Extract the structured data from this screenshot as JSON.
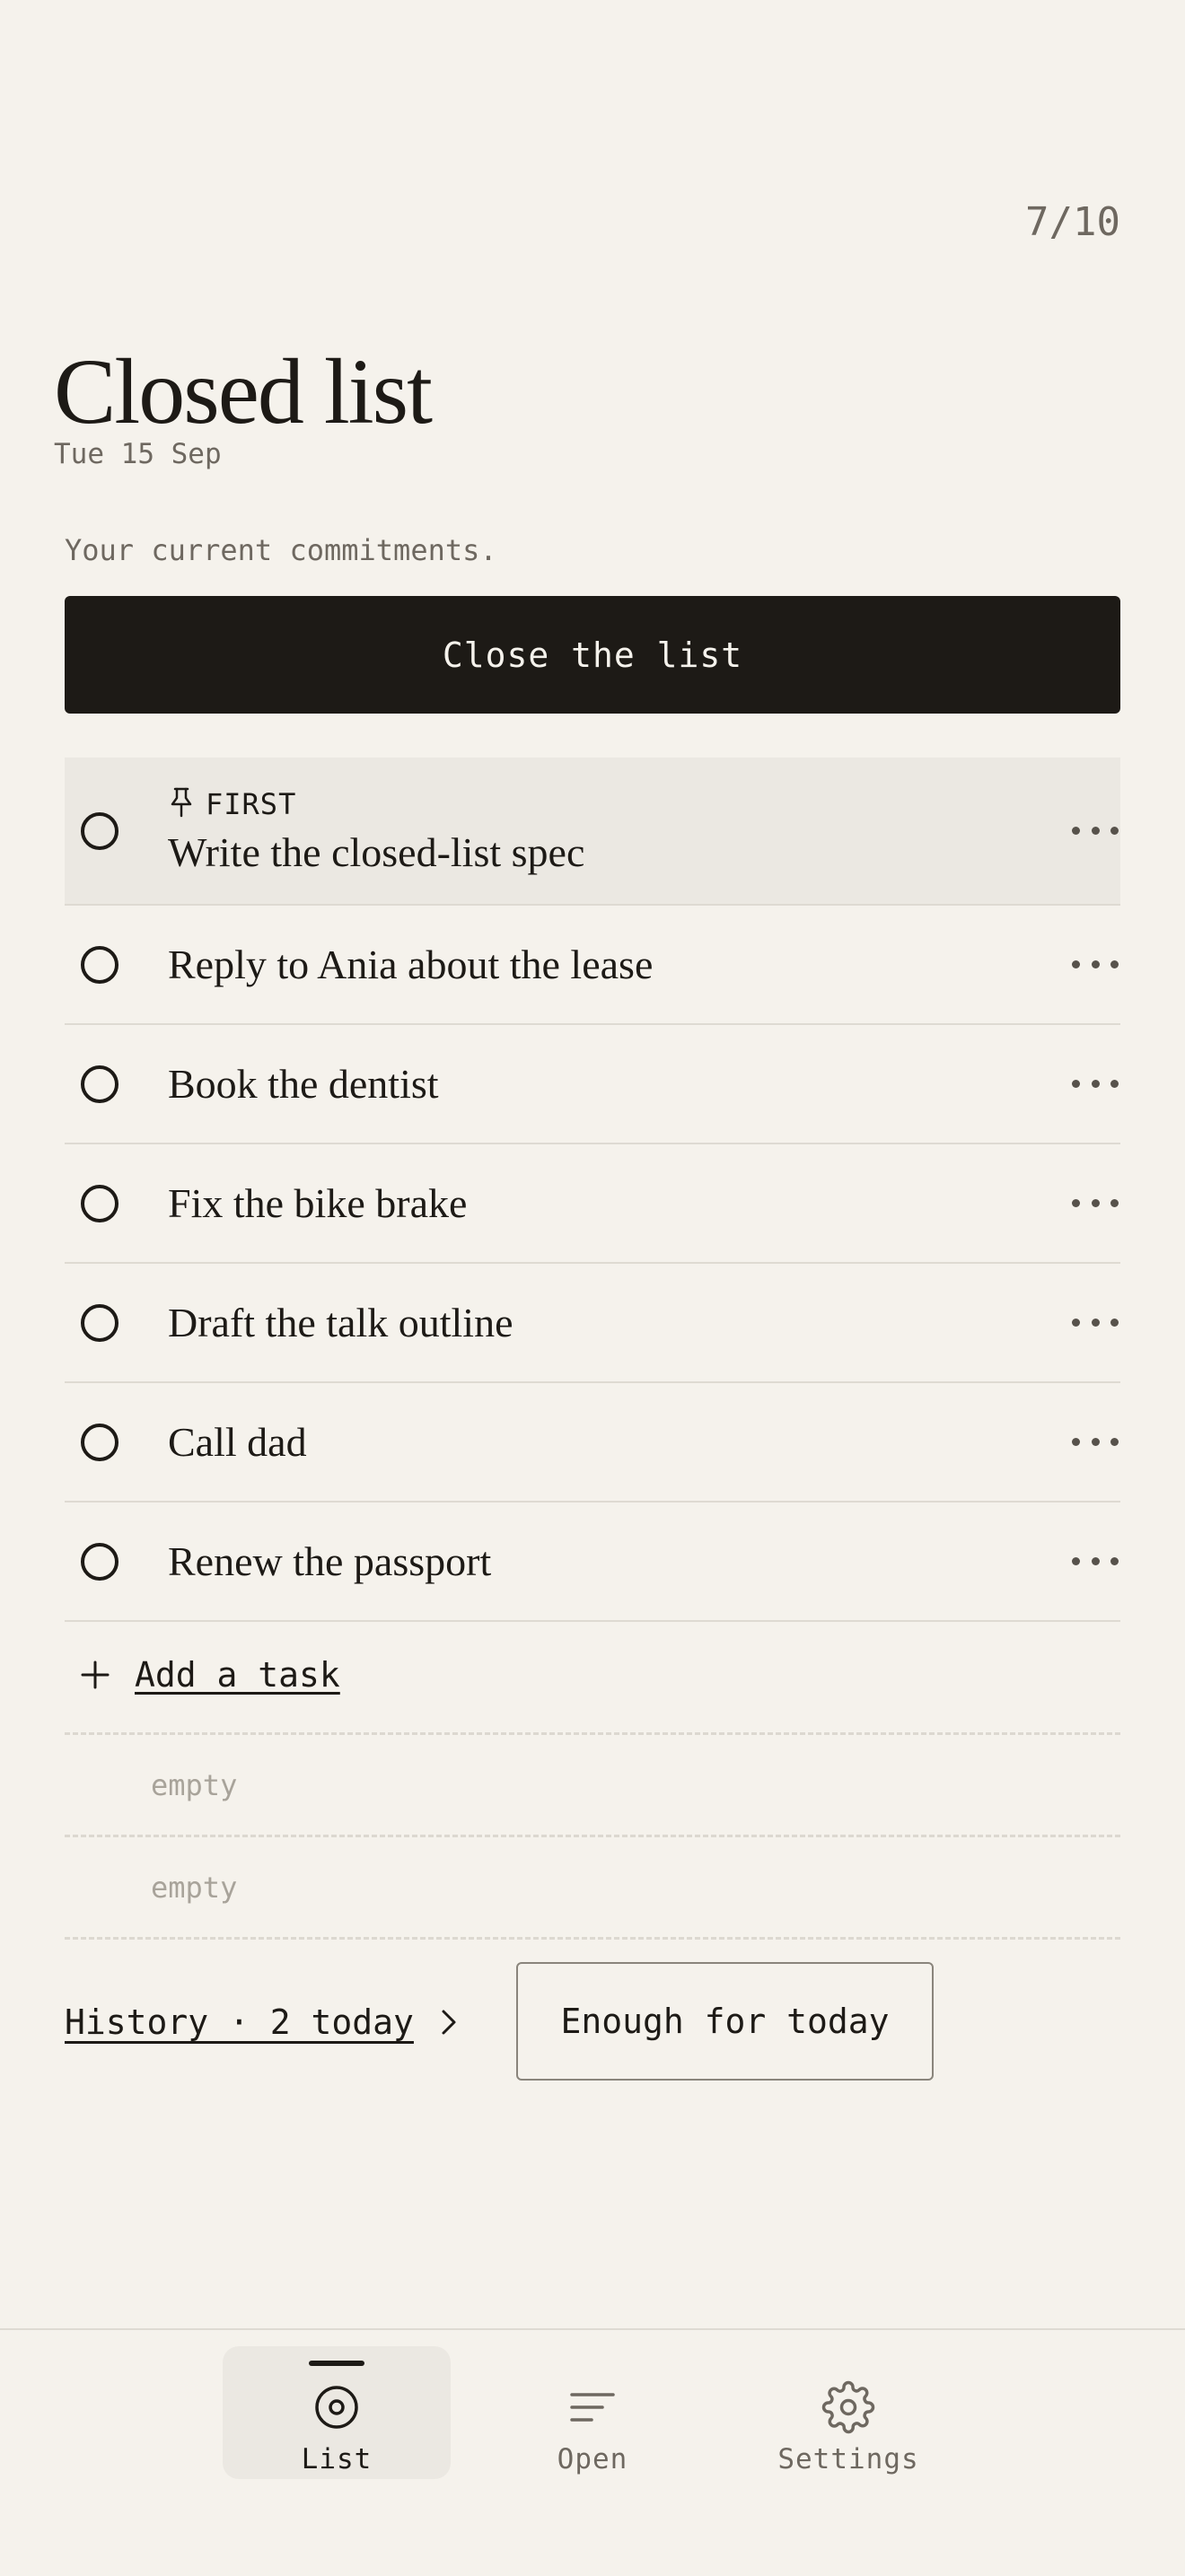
{
  "header": {
    "count": "7/10",
    "title": "Closed list",
    "date": "Tue 15 Sep",
    "caption": "Your current commitments."
  },
  "close_button": {
    "label": "Close the list"
  },
  "tasks": [
    {
      "text": "Write the closed-list spec",
      "pinned": true,
      "pin_label": "FIRST"
    },
    {
      "text": "Reply to Ania about the lease"
    },
    {
      "text": "Book the dentist"
    },
    {
      "text": "Fix the bike brake"
    },
    {
      "text": "Draft the talk outline"
    },
    {
      "text": "Call dad"
    },
    {
      "text": "Renew the passport"
    }
  ],
  "add_task": {
    "label": "Add a task"
  },
  "empty_slots": [
    "empty",
    "empty"
  ],
  "history": {
    "label": "History · 2 today"
  },
  "enough_button": {
    "label": "Enough for today"
  },
  "tabs": [
    {
      "label": "List",
      "icon": "target-icon",
      "active": true
    },
    {
      "label": "Open",
      "icon": "lines-icon",
      "active": false
    },
    {
      "label": "Settings",
      "icon": "gear-icon",
      "active": false
    }
  ],
  "colors": {
    "background": "#f5f2ec",
    "ink": "#1d1a16",
    "muted": "#6e6860",
    "highlight": "#ebe8e2"
  }
}
